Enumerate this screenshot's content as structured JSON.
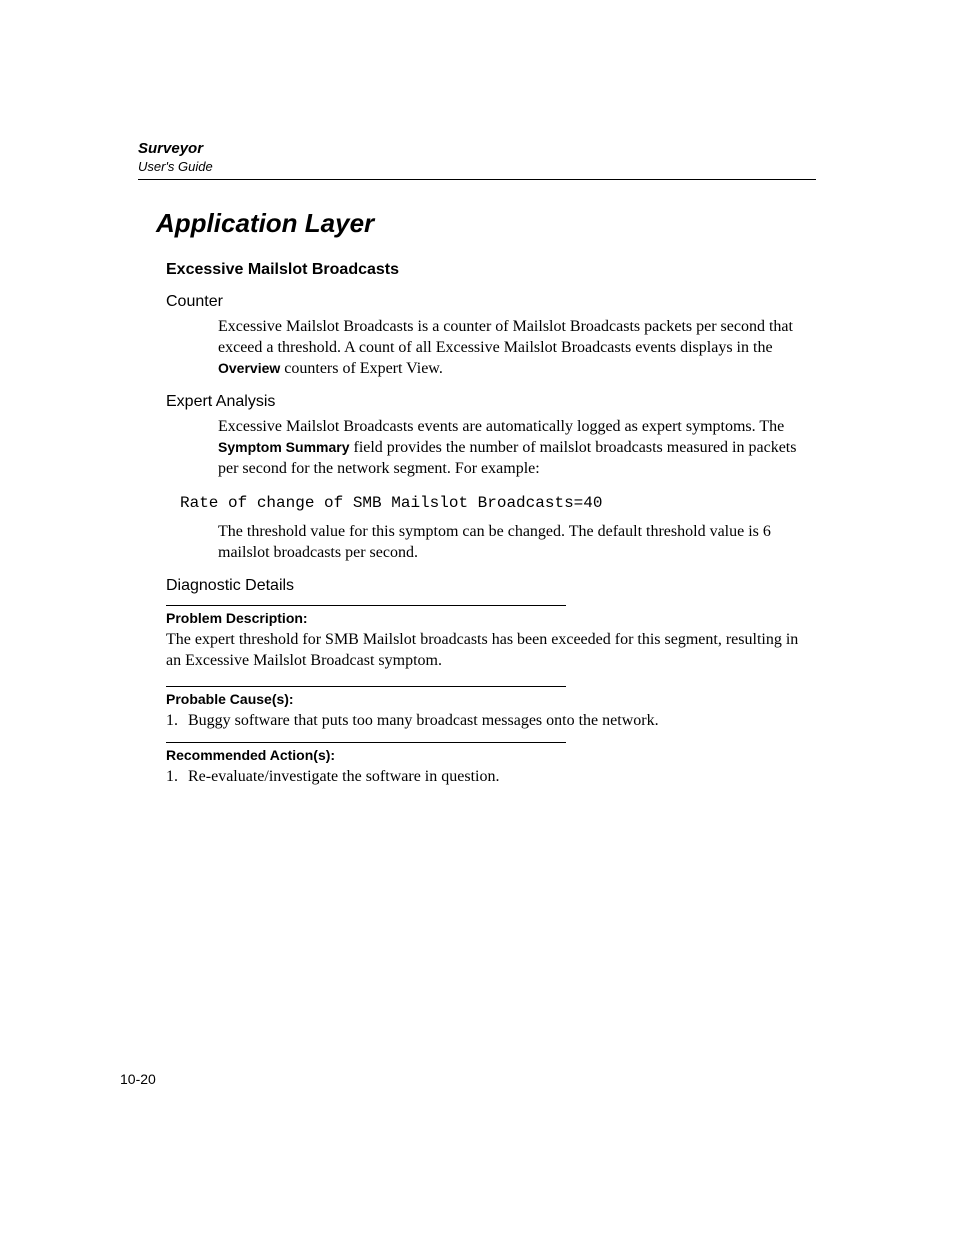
{
  "header": {
    "product": "Surveyor",
    "doc": "User's Guide"
  },
  "title": "Application Layer",
  "section": {
    "heading": "Excessive Mailslot Broadcasts",
    "counter": {
      "label": "Counter",
      "text_parts": {
        "p1a": "Excessive Mailslot Broadcasts is a counter of Mailslot Broadcasts packets per second that exceed a threshold. A count of all Excessive Mailslot Broadcasts events displays in the ",
        "p1b": "Overview",
        "p1c": " counters of Expert View."
      }
    },
    "expert": {
      "label": "Expert Analysis",
      "text_parts": {
        "p1a": "Excessive Mailslot Broadcasts events are automatically logged as expert symptoms. The ",
        "p1b": "Symptom Summary",
        "p1c": " field provides the number of mailslot broadcasts measured in packets per second for the network segment. For example:"
      },
      "code": "Rate of change of SMB Mailslot Broadcasts=40",
      "text2": "The threshold value for this symptom can be changed. The default threshold value is 6 mailslot broadcasts per second."
    },
    "diag": {
      "label": "Diagnostic Details",
      "problem": {
        "label": "Problem Description:",
        "text": "The expert threshold for SMB Mailslot broadcasts has been exceeded for this segment, resulting in an Excessive Mailslot Broadcast symptom."
      },
      "cause": {
        "label": "Probable Cause(s):",
        "items": [
          "Buggy software that puts too many broadcast messages onto the network."
        ]
      },
      "action": {
        "label": "Recommended Action(s):",
        "items": [
          "Re-evaluate/investigate the software in question."
        ]
      }
    }
  },
  "page_number": "10-20"
}
